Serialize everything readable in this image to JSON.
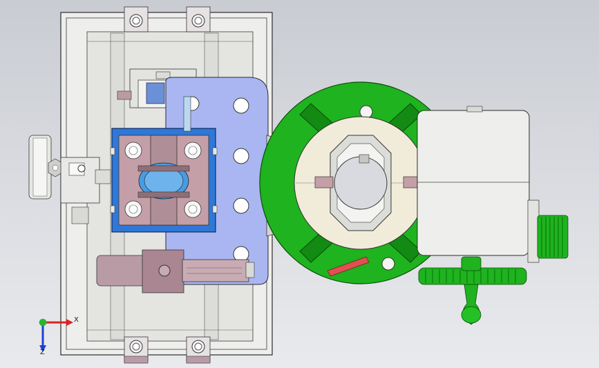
{
  "viewport": {
    "background_top": "#c9ccd2",
    "background_bottom": "#e9eaed"
  },
  "colors": {
    "frame": "#eeeeec",
    "frame_edge": "#2b2b2b",
    "steel": "#d9d9d6",
    "steel_dark": "#a9a9a6",
    "blue_plate": "#a9b6f1",
    "mauve": "#b99ba6",
    "mauve_dark": "#8d6f79",
    "cyan": "#2f78d8",
    "green": "#1fb31f",
    "green_dark": "#0c7a0c",
    "red": "#e05050",
    "axis_x": "#e02020",
    "axis_y": "#2bb52b",
    "axis_z": "#2040d0"
  },
  "triad": {
    "x_label": "X",
    "z_label": "Z"
  }
}
